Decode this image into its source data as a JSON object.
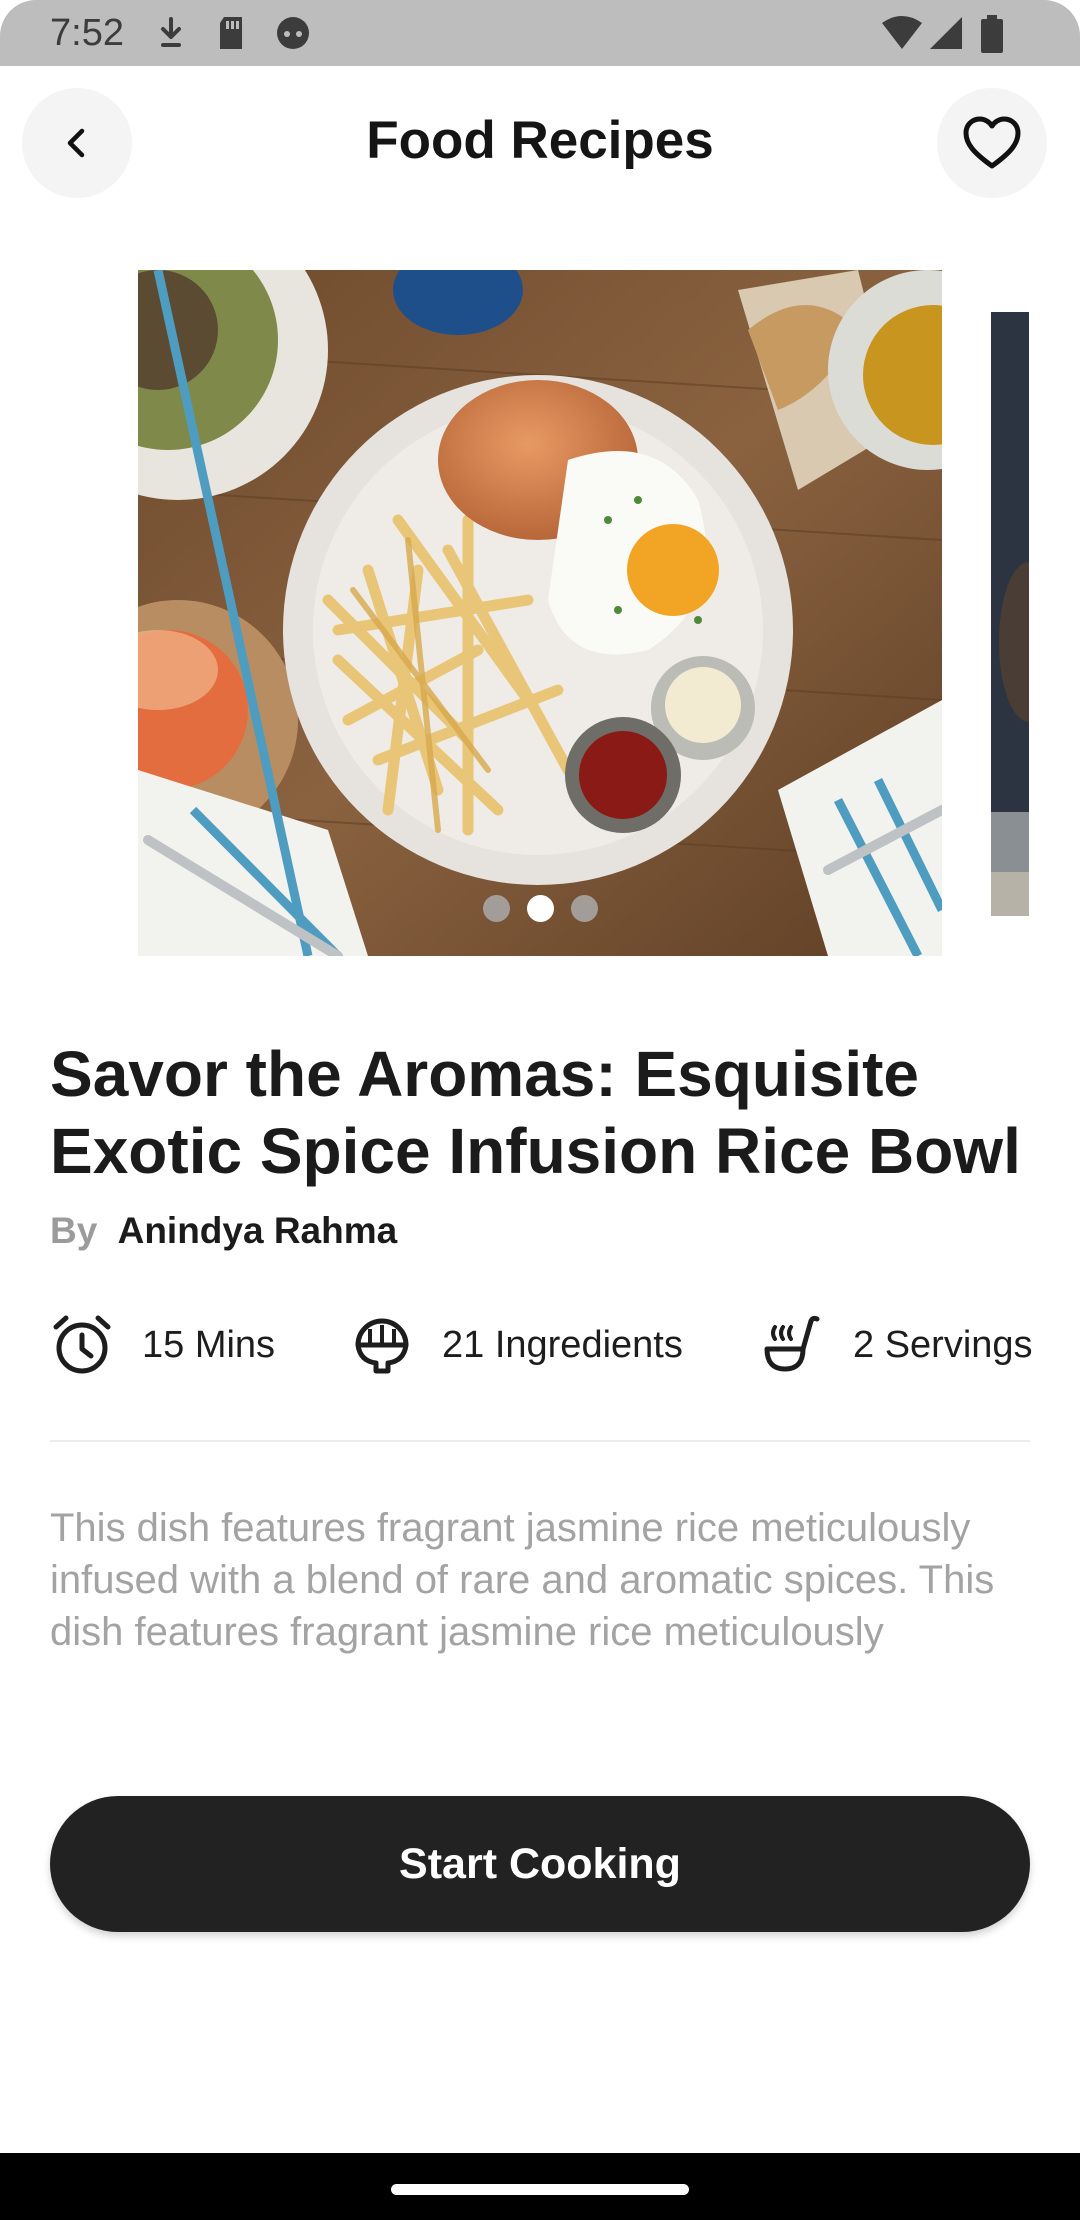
{
  "status_bar": {
    "time": "7:52"
  },
  "header": {
    "title": "Food Recipes",
    "back_icon": "chevron-left-icon",
    "favorite_icon": "heart-outline-icon"
  },
  "carousel": {
    "slide_count": 3,
    "active_index": 1
  },
  "recipe": {
    "title": "Savor the Aromas: Esquisite Exotic Spice Infusion Rice Bowl",
    "by_label": "By",
    "author": "Anindya Rahma",
    "stats": [
      {
        "icon": "alarm-clock-icon",
        "label": "15 Mins"
      },
      {
        "icon": "rice-bowl-icon",
        "label": "21 Ingredients"
      },
      {
        "icon": "ladle-steam-icon",
        "label": "2 Servings"
      }
    ],
    "description": "This dish features fragrant jasmine rice meticulously infused with a blend of rare and aromatic spices. This dish features fragrant jasmine rice meticulously"
  },
  "actions": {
    "start_label": "Start Cooking"
  },
  "colors": {
    "button_bg": "#222222",
    "description_text": "#a3a3a3",
    "status_bar_bg": "#bdbdbd"
  }
}
